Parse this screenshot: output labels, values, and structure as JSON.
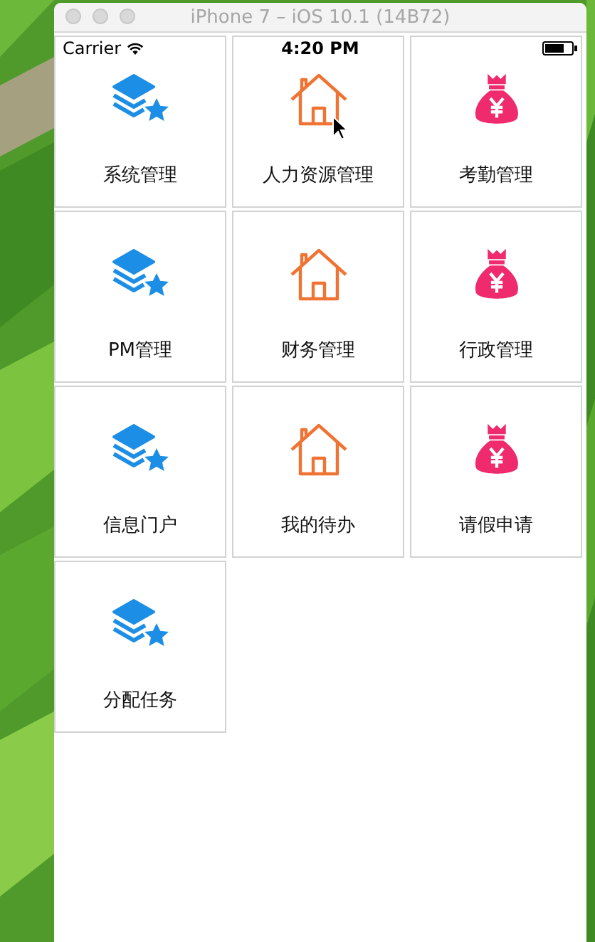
{
  "window": {
    "title": "iPhone 7 – iOS 10.1 (14B72)"
  },
  "status_bar": {
    "carrier": "Carrier",
    "time": "4:20 PM"
  },
  "items": [
    {
      "label": "系统管理",
      "kind": "layers"
    },
    {
      "label": "人力资源管理",
      "kind": "house"
    },
    {
      "label": "考勤管理",
      "kind": "bag"
    },
    {
      "label": "PM管理",
      "kind": "layers"
    },
    {
      "label": "财务管理",
      "kind": "house"
    },
    {
      "label": "行政管理",
      "kind": "bag"
    },
    {
      "label": "信息门户",
      "kind": "layers"
    },
    {
      "label": "我的待办",
      "kind": "house"
    },
    {
      "label": "请假申请",
      "kind": "bag"
    },
    {
      "label": "分配任务",
      "kind": "layers"
    }
  ]
}
